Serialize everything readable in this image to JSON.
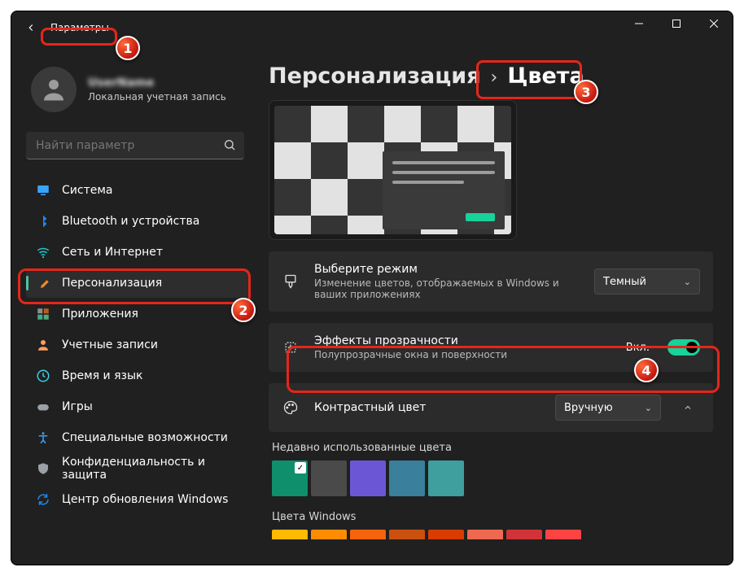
{
  "titlebar": {
    "title": "Параметры"
  },
  "user": {
    "name": "UserName",
    "subtitle": "Локальная учетная запись"
  },
  "search": {
    "placeholder": "Найти параметр"
  },
  "sidebar": {
    "items": [
      {
        "label": "Система",
        "icon": "monitor",
        "color": "#3aa2ff"
      },
      {
        "label": "Bluetooth и устройства",
        "icon": "bluetooth",
        "color": "#1c8af0"
      },
      {
        "label": "Сеть и Интернет",
        "icon": "wifi",
        "color": "#19c6d0"
      },
      {
        "label": "Персонализация",
        "icon": "brush",
        "color": "#f08c2e",
        "active": true
      },
      {
        "label": "Приложения",
        "icon": "apps",
        "color": "#8d8d8d"
      },
      {
        "label": "Учетные записи",
        "icon": "person",
        "color": "#ff9d61"
      },
      {
        "label": "Время и язык",
        "icon": "clock",
        "color": "#3ad0e6"
      },
      {
        "label": "Игры",
        "icon": "gamepad",
        "color": "#9aa0a6"
      },
      {
        "label": "Специальные возможности",
        "icon": "accessibility",
        "color": "#3aa2ff"
      },
      {
        "label": "Конфиденциальность и защита",
        "icon": "shield",
        "color": "#9aa0a6"
      },
      {
        "label": "Центр обновления Windows",
        "icon": "update",
        "color": "#1c8af0"
      }
    ]
  },
  "breadcrumb": {
    "parent": "Персонализация",
    "current": "Цвета"
  },
  "cards": {
    "mode": {
      "title": "Выберите режим",
      "subtitle": "Изменение цветов, отображаемых в Windows и ваших приложениях",
      "value": "Темный"
    },
    "transparency": {
      "title": "Эффекты прозрачности",
      "subtitle": "Полупрозрачные окна и поверхности",
      "state_label": "Вкл."
    },
    "accent": {
      "title": "Контрастный цвет",
      "value": "Вручную"
    }
  },
  "recent": {
    "heading": "Недавно использованные цвета",
    "colors": [
      "#0f8f6b",
      "#4a4a4a",
      "#6b57d6",
      "#3a7f9b",
      "#3f9e9e"
    ]
  },
  "windows_colors": {
    "heading": "Цвета Windows",
    "row": [
      "#ffb900",
      "#ff8c00",
      "#f7630c",
      "#ca5010",
      "#da3b01",
      "#ef6950",
      "#d13438",
      "#ff4343"
    ]
  },
  "annotations": {
    "1": "1",
    "2": "2",
    "3": "3",
    "4": "4"
  }
}
